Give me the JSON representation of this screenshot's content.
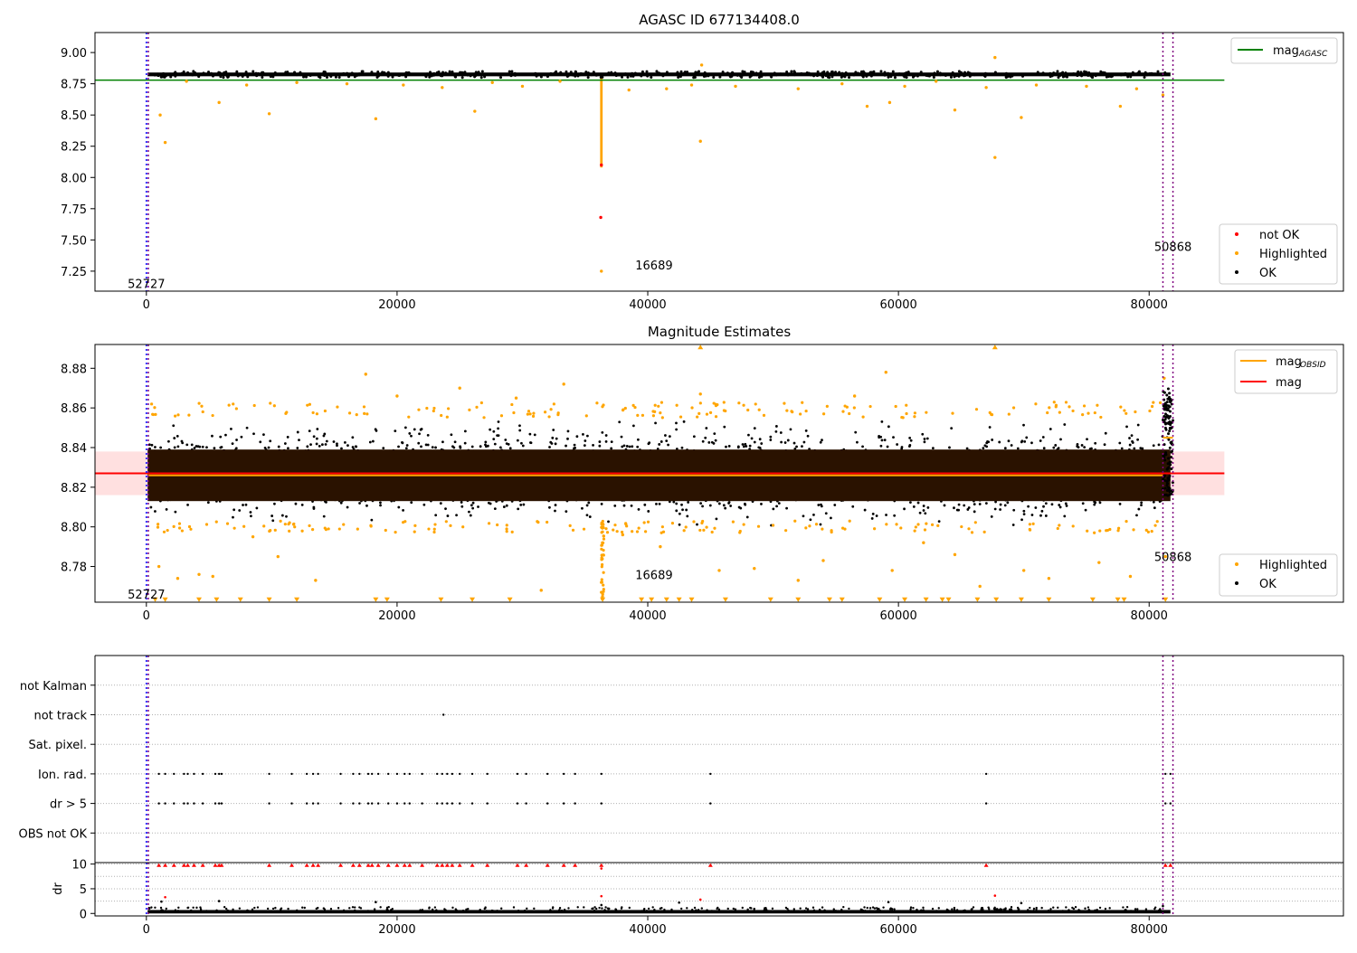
{
  "chart_data": [
    {
      "type": "scatter",
      "title": "AGASC ID 677134408.0",
      "xlabel": "",
      "ylabel": "",
      "xlim": [
        -4100,
        95500
      ],
      "ylim": [
        7.09,
        9.16
      ],
      "xticks": [
        0,
        20000,
        40000,
        60000,
        80000
      ],
      "xtick_labels": [
        "0",
        "20000",
        "40000",
        "60000",
        "80000"
      ],
      "yticks": [
        7.25,
        7.5,
        7.75,
        8.0,
        8.25,
        8.5,
        8.75,
        9.0
      ],
      "ytick_labels": [
        "7.25",
        "7.50",
        "7.75",
        "8.00",
        "8.25",
        "8.50",
        "8.75",
        "9.00"
      ],
      "grid": false,
      "legend_placement": "top-right",
      "legend_entries": [
        "not OK",
        "Highlighted",
        "OK"
      ],
      "line_legend": "mag",
      "line_legend_sub": "AGASC",
      "lines": [
        {
          "x": [
            -4100,
            86000
          ],
          "y": [
            8.779,
            8.779
          ],
          "color": "#008000"
        }
      ],
      "bands": [
        {
          "x": [
            100,
            81700
          ],
          "y": [
            8.81,
            8.84
          ],
          "color": "#000000",
          "note": "dense OK points"
        },
        {
          "x": [
            36200,
            36400
          ],
          "y": [
            8.08,
            8.81
          ],
          "color": "#ffa500",
          "note": "dip of highlighted points"
        }
      ],
      "points_not_ok": [
        [
          36250,
          7.68
        ],
        [
          36300,
          8.1
        ]
      ],
      "points_highlighted": [
        [
          1100,
          8.5
        ],
        [
          1500,
          8.28
        ],
        [
          5800,
          8.6
        ],
        [
          9800,
          8.51
        ],
        [
          18300,
          8.47
        ],
        [
          26200,
          8.53
        ],
        [
          44200,
          8.29
        ],
        [
          57500,
          8.57
        ],
        [
          59300,
          8.6
        ],
        [
          64500,
          8.54
        ],
        [
          67700,
          8.16
        ],
        [
          67700,
          8.96
        ],
        [
          69800,
          8.48
        ],
        [
          77700,
          8.57
        ],
        [
          81100,
          8.66
        ],
        [
          36300,
          7.25
        ],
        [
          3200,
          8.77
        ],
        [
          8000,
          8.74
        ],
        [
          12000,
          8.76
        ],
        [
          16000,
          8.75
        ],
        [
          20500,
          8.74
        ],
        [
          23600,
          8.72
        ],
        [
          27600,
          8.76
        ],
        [
          30000,
          8.73
        ],
        [
          33000,
          8.77
        ],
        [
          38500,
          8.7
        ],
        [
          41500,
          8.71
        ],
        [
          43500,
          8.74
        ],
        [
          47000,
          8.73
        ],
        [
          52000,
          8.71
        ],
        [
          55500,
          8.75
        ],
        [
          60500,
          8.73
        ],
        [
          63000,
          8.77
        ],
        [
          67000,
          8.72
        ],
        [
          71000,
          8.74
        ],
        [
          75000,
          8.73
        ],
        [
          79000,
          8.71
        ],
        [
          44300,
          8.9
        ]
      ],
      "vlines": [
        {
          "x": 0,
          "color": "#0000ff"
        },
        {
          "x": 150,
          "color": "#800080"
        },
        {
          "x": 81100,
          "color": "#800080"
        },
        {
          "x": 81900,
          "color": "#800080"
        }
      ],
      "annotations": [
        {
          "text": "52727",
          "x": 0,
          "y": 7.15
        },
        {
          "text": "16689",
          "x": 40500,
          "y": 7.3
        },
        {
          "text": "50868",
          "x": 81900,
          "y": 7.45
        }
      ]
    },
    {
      "type": "scatter",
      "title": "Magnitude Estimates",
      "xlabel": "",
      "ylabel": "",
      "xlim": [
        -4100,
        95500
      ],
      "ylim": [
        8.762,
        8.892
      ],
      "xticks": [
        0,
        20000,
        40000,
        60000,
        80000
      ],
      "xtick_labels": [
        "0",
        "20000",
        "40000",
        "60000",
        "80000"
      ],
      "yticks": [
        8.78,
        8.8,
        8.82,
        8.84,
        8.86,
        8.88
      ],
      "ytick_labels": [
        "8.78",
        "8.80",
        "8.82",
        "8.84",
        "8.86",
        "8.88"
      ],
      "grid": false,
      "legend_placement": "top-right",
      "legend_entries": [
        "Highlighted",
        "OK"
      ],
      "line_legend": "mag",
      "line_legend_sub": "OBSID",
      "line_legend_2": "mag",
      "shaded_range": {
        "x": [
          -4100,
          86000
        ],
        "y": [
          8.816,
          8.838
        ],
        "color": "#ffe0e0"
      },
      "lines": [
        {
          "x": [
            -4100,
            86000
          ],
          "y": [
            8.827,
            8.827
          ],
          "color": "#ff0000"
        },
        {
          "x": [
            150,
            81100
          ],
          "y": [
            8.826,
            8.826
          ],
          "color": "#ffa500"
        },
        {
          "x": [
            81100,
            81900
          ],
          "y": [
            8.845,
            8.845
          ],
          "color": "#ffa500"
        }
      ],
      "bands": [
        {
          "x": [
            100,
            81700
          ],
          "y": [
            8.813,
            8.839
          ],
          "color": "#2a1200",
          "note": "dense OK points with overlap"
        }
      ],
      "points_highlighted": [
        [
          1000,
          8.78
        ],
        [
          2500,
          8.774
        ],
        [
          4200,
          8.776
        ],
        [
          5300,
          8.775
        ],
        [
          8500,
          8.795
        ],
        [
          10500,
          8.785
        ],
        [
          13500,
          8.773
        ],
        [
          17500,
          8.877
        ],
        [
          20000,
          8.866
        ],
        [
          25000,
          8.87
        ],
        [
          29500,
          8.865
        ],
        [
          31500,
          8.768
        ],
        [
          33300,
          8.872
        ],
        [
          36300,
          8.767
        ],
        [
          36300,
          8.772
        ],
        [
          38000,
          8.796
        ],
        [
          41000,
          8.79
        ],
        [
          44200,
          8.867
        ],
        [
          45700,
          8.778
        ],
        [
          48500,
          8.779
        ],
        [
          52000,
          8.773
        ],
        [
          54000,
          8.783
        ],
        [
          56500,
          8.866
        ],
        [
          59000,
          8.878
        ],
        [
          59500,
          8.778
        ],
        [
          62000,
          8.792
        ],
        [
          64500,
          8.786
        ],
        [
          66500,
          8.77
        ],
        [
          70000,
          8.778
        ],
        [
          72000,
          8.774
        ],
        [
          76000,
          8.782
        ],
        [
          78500,
          8.775
        ],
        [
          81200,
          8.875
        ],
        [
          81300,
          8.785
        ]
      ],
      "points_highlighted_clipped_x": [
        [
          700,
          8.763
        ],
        [
          1500,
          8.763
        ],
        [
          4200,
          8.763
        ],
        [
          5600,
          8.763
        ],
        [
          7500,
          8.763
        ],
        [
          9800,
          8.763
        ],
        [
          12000,
          8.763
        ],
        [
          18300,
          8.763
        ],
        [
          19200,
          8.763
        ],
        [
          23500,
          8.763
        ],
        [
          26000,
          8.763
        ],
        [
          29000,
          8.763
        ],
        [
          36400,
          8.763
        ],
        [
          39500,
          8.763
        ],
        [
          40300,
          8.763
        ],
        [
          41500,
          8.763
        ],
        [
          42500,
          8.763
        ],
        [
          43500,
          8.763
        ],
        [
          46200,
          8.763
        ],
        [
          49800,
          8.763
        ],
        [
          52000,
          8.763
        ],
        [
          54500,
          8.763
        ],
        [
          55500,
          8.763
        ],
        [
          58500,
          8.763
        ],
        [
          60500,
          8.763
        ],
        [
          62200,
          8.763
        ],
        [
          63500,
          8.763
        ],
        [
          64000,
          8.763
        ],
        [
          66300,
          8.763
        ],
        [
          67800,
          8.763
        ],
        [
          69800,
          8.763
        ],
        [
          72000,
          8.763
        ],
        [
          75500,
          8.763
        ],
        [
          77500,
          8.763
        ],
        [
          78000,
          8.763
        ],
        [
          81300,
          8.763
        ]
      ],
      "points_highlighted_clipped_top": [
        [
          44200,
          8.891
        ],
        [
          67700,
          8.891
        ]
      ],
      "vlines": [
        {
          "x": 0,
          "color": "#0000ff"
        },
        {
          "x": 150,
          "color": "#800080"
        },
        {
          "x": 81100,
          "color": "#800080"
        },
        {
          "x": 81900,
          "color": "#800080"
        }
      ],
      "annotations": [
        {
          "text": "52727",
          "x": 0,
          "y": 8.766
        },
        {
          "text": "16689",
          "x": 40500,
          "y": 8.776
        },
        {
          "text": "50868",
          "x": 81900,
          "y": 8.785
        }
      ]
    },
    {
      "type": "scatter",
      "title": "",
      "xlabel": "",
      "ylabel": "",
      "xlim": [
        -4100,
        95500
      ],
      "yticks": [
        1,
        2,
        3,
        4,
        5,
        6
      ],
      "ytick_labels": [
        "OBS not OK",
        "dr > 5",
        "Ion. rad.",
        "Sat. pixel.",
        "not track",
        "not Kalman"
      ],
      "grid": "horizontal dotted",
      "flag_points": {
        "Ion. rad.": [
          1000,
          1500,
          2200,
          3000,
          3300,
          3800,
          4500,
          5500,
          5800,
          6000,
          9800,
          11600,
          12800,
          13300,
          13700,
          15500,
          16500,
          17000,
          17700,
          18000,
          18500,
          19300,
          20000,
          20600,
          21000,
          22000,
          23200,
          23600,
          24000,
          24400,
          25000,
          26000,
          27200,
          29600,
          30300,
          32000,
          33300,
          34200,
          36300,
          45000,
          67000,
          81300,
          81700
        ],
        "dr > 5": [
          1000,
          1500,
          2200,
          3000,
          3300,
          3800,
          4500,
          5500,
          5800,
          6000,
          9800,
          11600,
          12800,
          13300,
          13700,
          15500,
          16500,
          17000,
          17700,
          18000,
          18500,
          19300,
          20000,
          20600,
          21000,
          22000,
          23200,
          23600,
          24000,
          24400,
          25000,
          26000,
          27200,
          29600,
          30300,
          32000,
          33300,
          34200,
          36300,
          45000,
          67000,
          81300,
          81700
        ],
        "not track": [
          23700
        ]
      },
      "vlines": [
        {
          "x": 0,
          "color": "#0000ff"
        },
        {
          "x": 150,
          "color": "#800080"
        },
        {
          "x": 81100,
          "color": "#800080"
        },
        {
          "x": 81900,
          "color": "#800080"
        }
      ]
    },
    {
      "type": "scatter",
      "title": "",
      "xlabel": "",
      "ylabel": "dr",
      "xlim": [
        -4100,
        95500
      ],
      "ylim": [
        -0.5,
        10.3
      ],
      "xticks": [
        0,
        20000,
        40000,
        60000,
        80000
      ],
      "xtick_labels": [
        "0",
        "20000",
        "40000",
        "60000",
        "80000"
      ],
      "yticks": [
        0,
        5,
        10
      ],
      "ytick_labels": [
        "0",
        "5",
        "10"
      ],
      "grid": "horizontal dotted",
      "baseline_band": {
        "x": [
          100,
          81700
        ],
        "y": [
          0,
          0.7
        ],
        "color": "#000000"
      },
      "points_red_clipped": [
        1000,
        1500,
        2200,
        3000,
        3300,
        3800,
        4500,
        5500,
        5800,
        6000,
        9800,
        11600,
        12800,
        13300,
        13700,
        15500,
        16500,
        17000,
        17700,
        18000,
        18500,
        19300,
        20000,
        20600,
        21000,
        22000,
        23200,
        23600,
        24000,
        24400,
        25000,
        26000,
        27200,
        29600,
        30300,
        32000,
        33300,
        34200,
        36300,
        45000,
        67000,
        81300,
        81700
      ],
      "points_red": [
        [
          1500,
          3.3
        ],
        [
          44200,
          2.8
        ],
        [
          36300,
          3.5
        ],
        [
          67700,
          3.6
        ],
        [
          36300,
          9.1
        ]
      ],
      "points_black": [
        [
          1200,
          2.4
        ],
        [
          5800,
          2.5
        ],
        [
          18300,
          2.3
        ],
        [
          36300,
          1.7
        ],
        [
          42500,
          2.2
        ],
        [
          59200,
          2.3
        ],
        [
          69800,
          2.1
        ],
        [
          81100,
          1.5
        ]
      ],
      "vlines": [
        {
          "x": 0,
          "color": "#0000ff"
        },
        {
          "x": 150,
          "color": "#800080"
        },
        {
          "x": 81100,
          "color": "#800080"
        },
        {
          "x": 81900,
          "color": "#800080"
        }
      ]
    }
  ]
}
